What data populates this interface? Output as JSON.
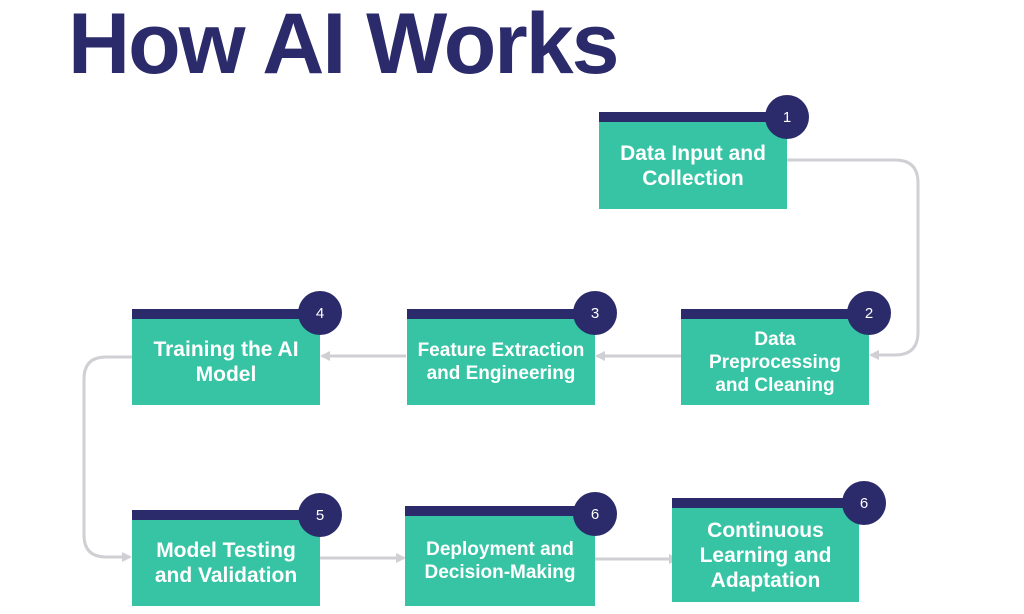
{
  "title": "How AI Works",
  "colors": {
    "title": "#2b2a6a",
    "box_fill": "#36c4a5",
    "box_top_bar": "#2b2a6a",
    "badge": "#2b2a6a",
    "connector": "#cfcfd4",
    "label_text": "#ffffff"
  },
  "steps": [
    {
      "number": "1",
      "label": "Data Input and Collection"
    },
    {
      "number": "2",
      "label": "Data Preprocessing and Cleaning"
    },
    {
      "number": "3",
      "label": "Feature Extraction and Engineering"
    },
    {
      "number": "4",
      "label": "Training the AI Model"
    },
    {
      "number": "5",
      "label": "Model Testing and Validation"
    },
    {
      "number": "6",
      "label": "Deployment and Decision-Making"
    },
    {
      "number": "6",
      "label": "Continuous Learning and Adaptation"
    }
  ]
}
